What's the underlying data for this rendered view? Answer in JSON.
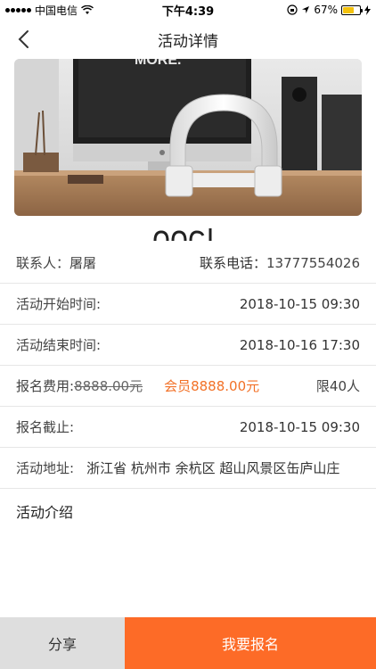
{
  "status_bar": {
    "carrier": "中国电信",
    "time": "下午4:39",
    "battery": "67%",
    "battery_level": 0.67
  },
  "nav": {
    "title": "活动详情"
  },
  "details": {
    "contact_label": "联系人：",
    "contact_name": "屠屠",
    "phone_label": "联系电话：",
    "phone": "13777554026",
    "start_label": "活动开始时间:",
    "start_value": "2018-10-15 09:30",
    "end_label": "活动结束时间:",
    "end_value": "2018-10-16 17:30",
    "fee_label": "报名费用:",
    "fee_original": "8888.00元",
    "fee_member": "会员8888.00元",
    "limit": "限40人",
    "deadline_label": "报名截止:",
    "deadline_value": "2018-10-15 09:30",
    "address_label": "活动地址:",
    "address_value": "浙江省 杭州市 余杭区 超山风景区缶庐山庄",
    "intro_label": "活动介绍"
  },
  "hero": {
    "sign_text": "MORE."
  },
  "bottom": {
    "share": "分享",
    "signup": "我要报名"
  },
  "colors": {
    "accent": "#fd6b27",
    "member_price": "#f27127",
    "share_bg": "#dedede"
  }
}
